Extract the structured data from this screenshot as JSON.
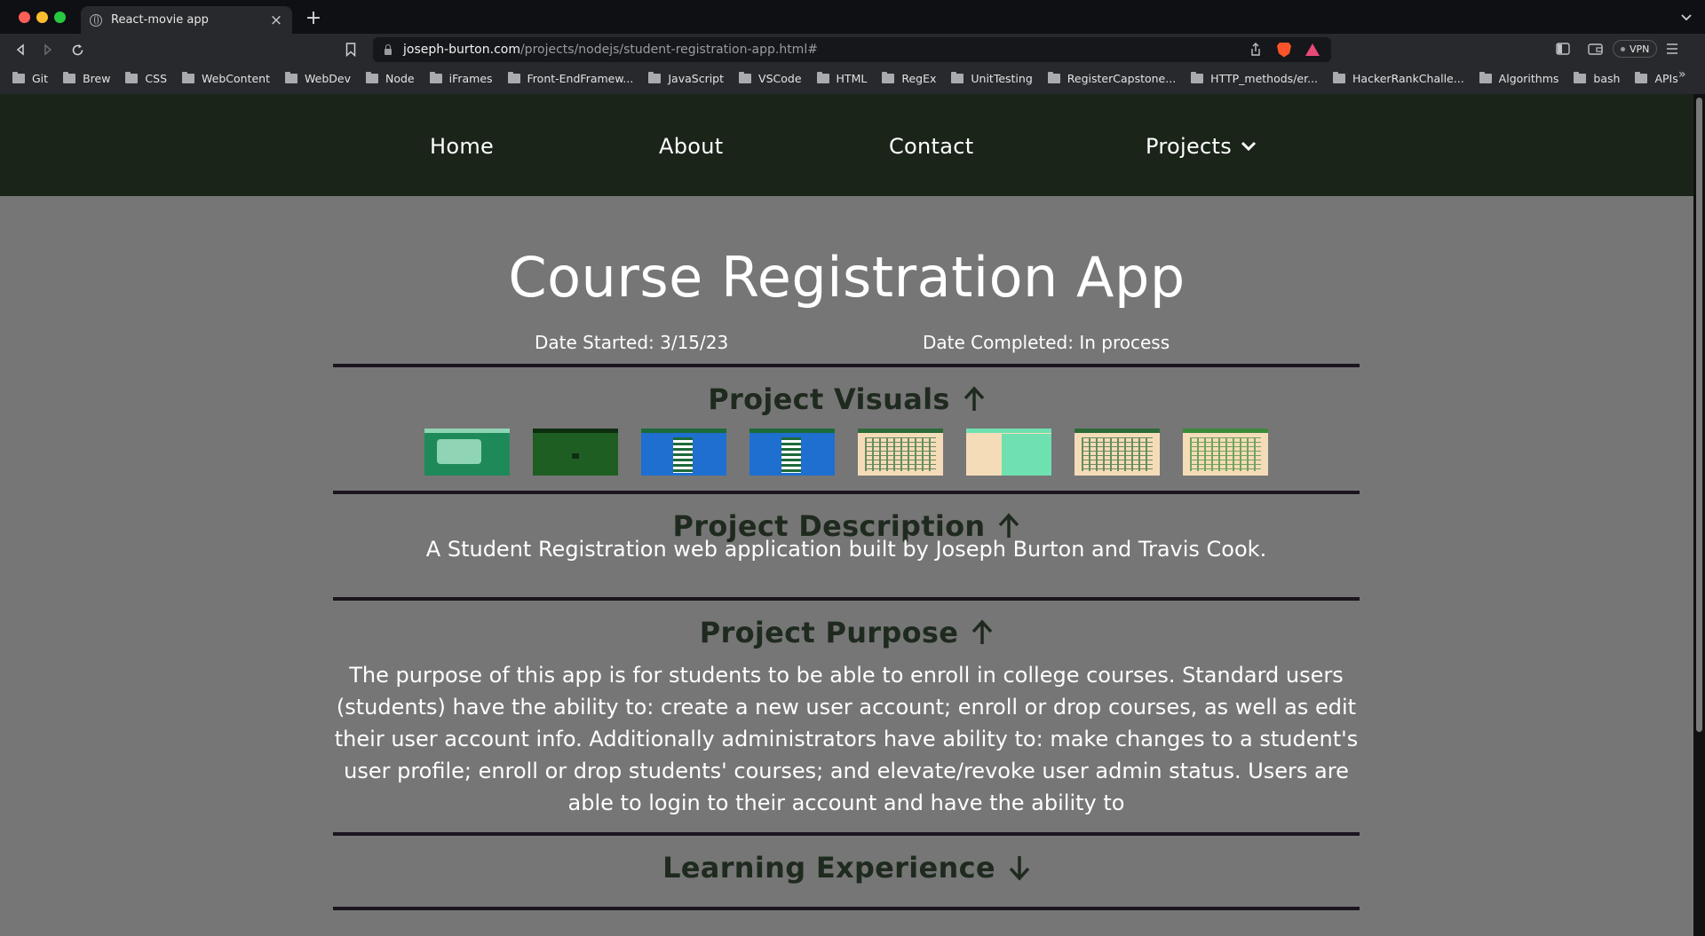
{
  "browser": {
    "tab_title": "React-movie app",
    "url_host": "joseph-burton.com",
    "url_path": "/projects/nodejs/student-registration-app.html#",
    "vpn_label": "VPN",
    "bookmarks": [
      "Git",
      "Brew",
      "CSS",
      "WebContent",
      "WebDev",
      "Node",
      "iFrames",
      "Front-EndFramew...",
      "JavaScript",
      "VSCode",
      "HTML",
      "RegEx",
      "UnitTesting",
      "RegisterCapstone...",
      "HTTP_methods/er...",
      "HackerRankChalle...",
      "Algorithms",
      "bash",
      "APIs"
    ],
    "bookmarks_overflow": "»"
  },
  "nav": {
    "home": "Home",
    "about": "About",
    "contact": "Contact",
    "projects": "Projects"
  },
  "page": {
    "title": "Course Registration App",
    "date_started": "Date Started: 3/15/23",
    "date_completed": "Date Completed: In process",
    "visuals_heading": "Project Visuals",
    "description_heading": "Project Description",
    "description": "A Student Registration web application built by Joseph Burton and Travis Cook.",
    "purpose_heading": "Project Purpose",
    "purpose": "The purpose of this app is for students to be able to enroll in college courses. Standard users (students) have the ability to: create a new user account; enroll or drop courses, as well as edit their user account info. Additionally administrators have ability to: make changes to a student's user profile; enroll or drop students' courses; and elevate/revoke user admin status. Users are able to login to their account and have the ability to",
    "learning_heading": "Learning Experience"
  },
  "thumbnails": [
    {
      "bg": "#1e8a5a",
      "accent": "#8fd4b4"
    },
    {
      "bg": "#1f5e22",
      "accent": "#0d2e10"
    },
    {
      "bg": "#1e6fd0",
      "accent": "#1d6a3a"
    },
    {
      "bg": "#1e6fd0",
      "accent": "#1d6a3a"
    },
    {
      "bg": "#f5dcb8",
      "accent": "#2d6a3a"
    },
    {
      "bg": "#f5dcb8",
      "accent": "#6fe0b0"
    },
    {
      "bg": "#f5dcb8",
      "accent": "#2d6a3a"
    },
    {
      "bg": "#f5dcb8",
      "accent": "#3a8a3a"
    }
  ],
  "colors": {
    "nav_bg": "#1a2419",
    "page_bg": "#767676",
    "heading_color": "#1f2a1e",
    "rule_color": "#1b1520"
  }
}
